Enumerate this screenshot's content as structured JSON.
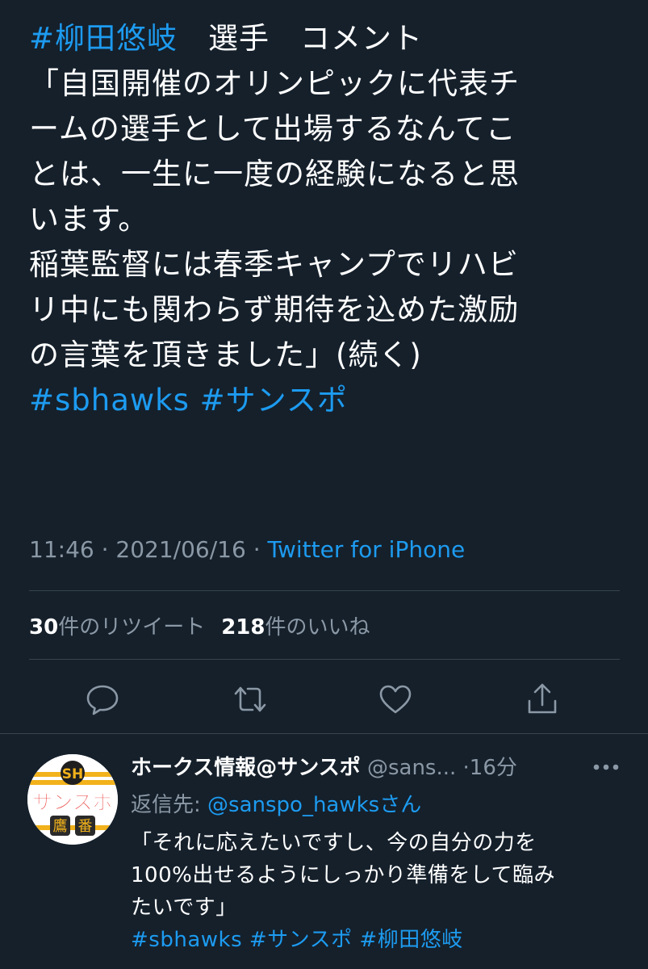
{
  "tweet": {
    "hashtag_player": "#柳田悠岐",
    "title_rest": "　選手　コメント",
    "body_lines": [
      "「自国開催のオリンピックに代表チ",
      "ームの選手として出場するなんてこ",
      "とは、一生に一度の経験になると思",
      "います。",
      "稲葉監督には春季キャンプでリハビ",
      "リ中にも関わらず期待を込めた激励",
      "の言葉を頂きました」(続く)"
    ],
    "hashtags": [
      "#sbhawks",
      "#サンスポ"
    ],
    "time": "11:46",
    "date": "2021/06/16",
    "separator": "·",
    "source": "Twitter for iPhone",
    "retweet_count": "30",
    "retweet_label": "件のリツイート",
    "like_count": "218",
    "like_label": "件のいいね"
  },
  "actions": {
    "reply_icon": "speech-bubble",
    "retweet_icon": "retweet-arrows",
    "like_icon": "heart",
    "share_icon": "share-upload"
  },
  "reply": {
    "name": "ホークス情報@サンスポ",
    "handle": "@sans...",
    "separator": "·",
    "time": "16分",
    "reply_to_label": "返信先: ",
    "reply_to_handle": "@sanspo_hawks",
    "reply_to_suffix": "さん",
    "text_lines": [
      "「それに応えたいですし、今の自分の力を",
      "100%出せるようにしっかり準備をして臨み",
      "たいです」"
    ],
    "hashtags": [
      "#sbhawks",
      "#サンスポ",
      "#柳田悠岐"
    ],
    "avatar": {
      "logo_text": "SH",
      "main_text": "サンスポ",
      "badge_1": "鷹",
      "badge_2": "番"
    }
  },
  "colors": {
    "background": "#15202b",
    "accent": "#1d9bf0",
    "secondary_text": "#8b98a5",
    "divider": "#38444d"
  }
}
